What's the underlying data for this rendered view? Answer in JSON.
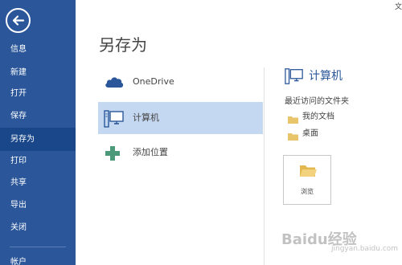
{
  "window": {
    "title_fragment": "文"
  },
  "sidebar": {
    "items": [
      {
        "label": "信息"
      },
      {
        "label": "新建"
      },
      {
        "label": "打开"
      },
      {
        "label": "保存"
      },
      {
        "label": "另存为"
      },
      {
        "label": "打印"
      },
      {
        "label": "共享"
      },
      {
        "label": "导出"
      },
      {
        "label": "关闭"
      },
      {
        "label": "帐户"
      }
    ],
    "selected": "另存为",
    "back_icon": "arrow-left-icon"
  },
  "main": {
    "title": "另存为",
    "locations": [
      {
        "label": "OneDrive",
        "icon": "cloud-icon"
      },
      {
        "label": "计算机",
        "icon": "computer-icon"
      },
      {
        "label": "添加位置",
        "icon": "plus-icon"
      }
    ],
    "selected_location": "计算机"
  },
  "right_panel": {
    "title": "计算机",
    "recent_heading": "最近访问的文件夹",
    "folders": [
      {
        "label": "我的文档"
      },
      {
        "label": "桌面"
      }
    ],
    "browse_label": "浏览"
  },
  "watermark": {
    "text": "Baidu经验",
    "sub": "jingyan.baidu.com"
  },
  "colors": {
    "sidebar": "#2b579a",
    "sidebar_selected": "#19478a",
    "location_selected": "#c5d8f1",
    "accent": "#2b579a"
  }
}
